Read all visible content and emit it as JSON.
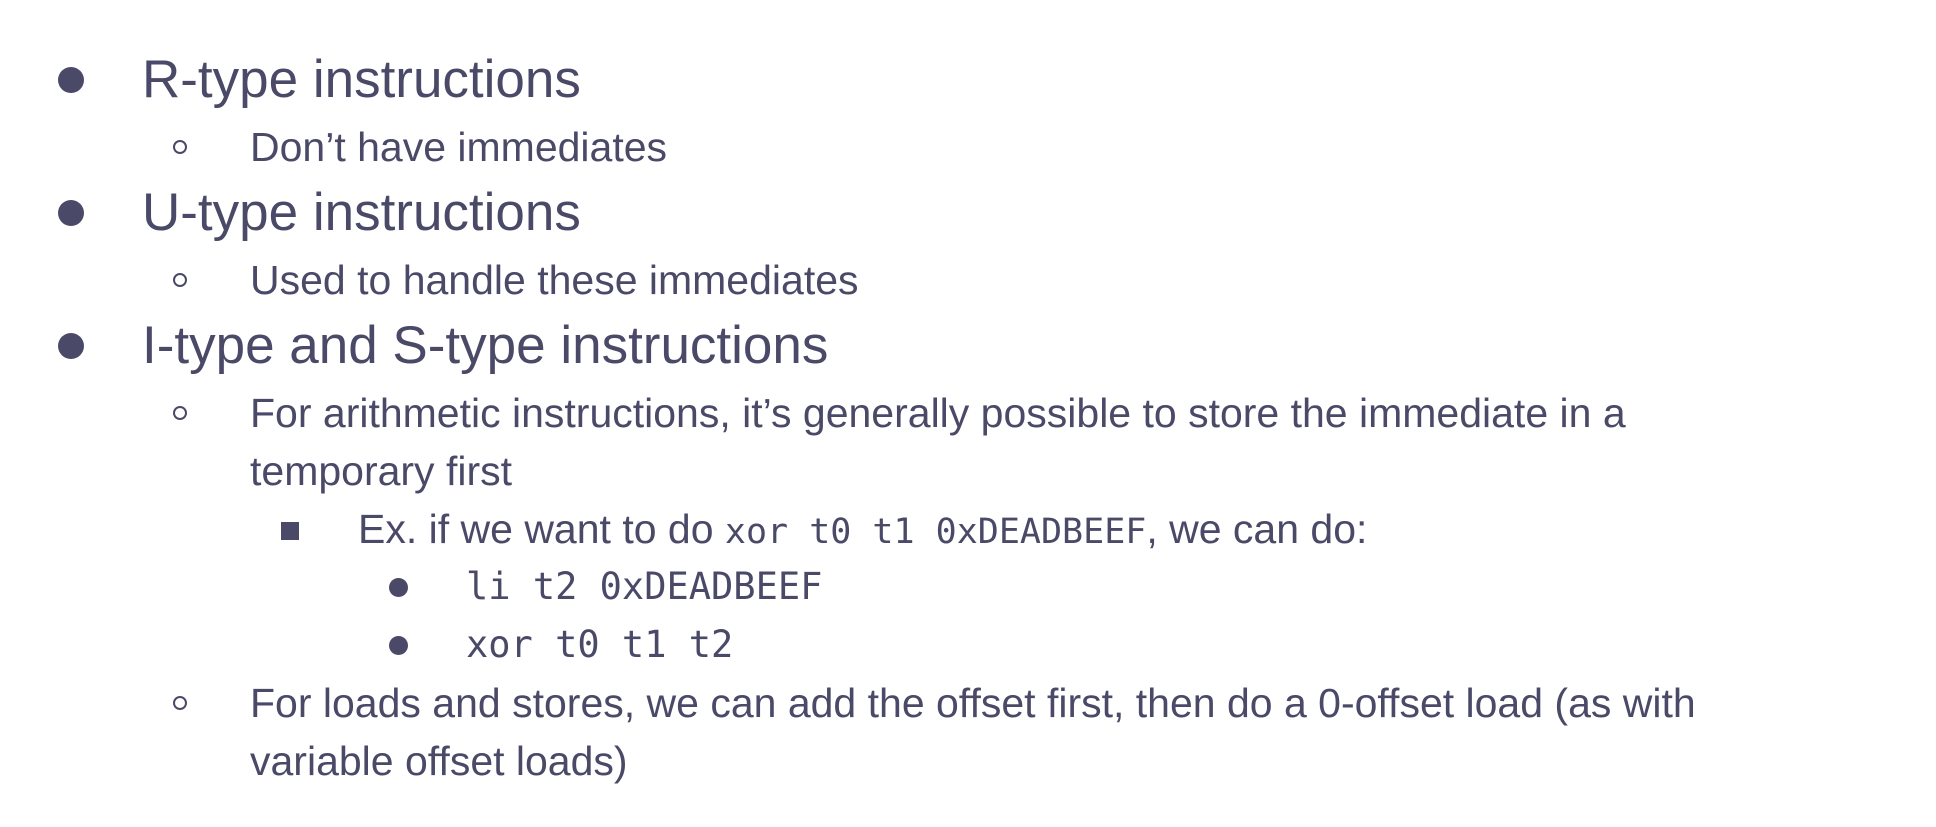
{
  "items": [
    {
      "level": 1,
      "text": "R-type instructions"
    },
    {
      "level": 2,
      "text": "Don’t have immediates"
    },
    {
      "level": 1,
      "text": "U-type instructions"
    },
    {
      "level": 2,
      "text": "Used to handle these immediates"
    },
    {
      "level": 1,
      "text": "I-type and S-type instructions"
    },
    {
      "level": 2,
      "lines": [
        "For arithmetic instructions, it’s generally possible to store the immediate in a",
        "temporary first"
      ]
    },
    {
      "level": 3,
      "prefix": "Ex. if we want to do ",
      "code": "xor t0 t1 0xDEADBEEF",
      "suffix": ", we can do:"
    },
    {
      "level": 4,
      "code": "li t2 0xDEADBEEF"
    },
    {
      "level": 4,
      "code": "xor t0 t1 t2"
    },
    {
      "level": 2,
      "lines": [
        "For loads and stores, we can add the offset first, then do a 0-offset load (as with",
        "variable offset loads)"
      ]
    }
  ],
  "colors": {
    "text": "#4a4a68",
    "background": "#ffffff"
  }
}
